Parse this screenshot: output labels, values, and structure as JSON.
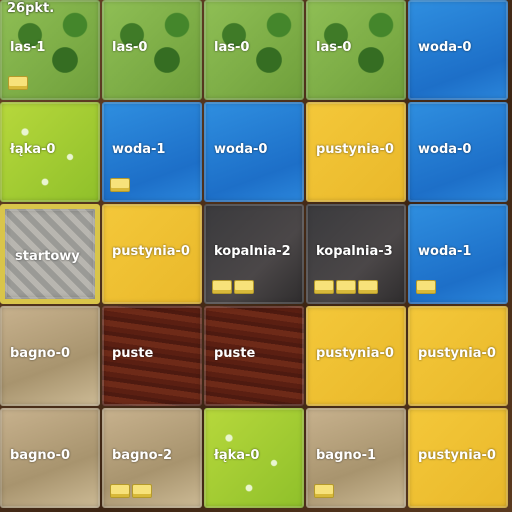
{
  "score": "26pkt.",
  "tile_colors": {
    "las": "#7aa844",
    "woda": "#2680d8",
    "laka": "#a6cd34",
    "pustynia": "#f0c133",
    "kopalnia": "#3d3b3c",
    "startowy": "#a9a8a3",
    "bagno": "#bba782",
    "puste": "#5e2315"
  },
  "grid": [
    [
      {
        "type": "las",
        "label": "las-1",
        "crowns": 1
      },
      {
        "type": "las",
        "label": "las-0",
        "crowns": 0
      },
      {
        "type": "las",
        "label": "las-0",
        "crowns": 0
      },
      {
        "type": "las",
        "label": "las-0",
        "crowns": 0
      },
      {
        "type": "woda",
        "label": "woda-0",
        "crowns": 0
      }
    ],
    [
      {
        "type": "laka",
        "label": "łąka-0",
        "crowns": 0
      },
      {
        "type": "woda",
        "label": "woda-1",
        "crowns": 1
      },
      {
        "type": "woda",
        "label": "woda-0",
        "crowns": 0
      },
      {
        "type": "pustynia",
        "label": "pustynia-0",
        "crowns": 0
      },
      {
        "type": "woda",
        "label": "woda-0",
        "crowns": 0
      }
    ],
    [
      {
        "type": "startowy",
        "label": "startowy",
        "crowns": 0
      },
      {
        "type": "pustynia",
        "label": "pustynia-0",
        "crowns": 0
      },
      {
        "type": "kopalnia",
        "label": "kopalnia-2",
        "crowns": 2
      },
      {
        "type": "kopalnia",
        "label": "kopalnia-3",
        "crowns": 3
      },
      {
        "type": "woda",
        "label": "woda-1",
        "crowns": 1
      }
    ],
    [
      {
        "type": "bagno",
        "label": "bagno-0",
        "crowns": 0
      },
      {
        "type": "puste",
        "label": "puste",
        "crowns": 0
      },
      {
        "type": "puste",
        "label": "puste",
        "crowns": 0
      },
      {
        "type": "pustynia",
        "label": "pustynia-0",
        "crowns": 0
      },
      {
        "type": "pustynia",
        "label": "pustynia-0",
        "crowns": 0
      }
    ],
    [
      {
        "type": "bagno",
        "label": "bagno-0",
        "crowns": 0
      },
      {
        "type": "bagno",
        "label": "bagno-2",
        "crowns": 2
      },
      {
        "type": "laka",
        "label": "łąka-0",
        "crowns": 0
      },
      {
        "type": "bagno",
        "label": "bagno-1",
        "crowns": 1
      },
      {
        "type": "pustynia",
        "label": "pustynia-0",
        "crowns": 0
      }
    ]
  ]
}
